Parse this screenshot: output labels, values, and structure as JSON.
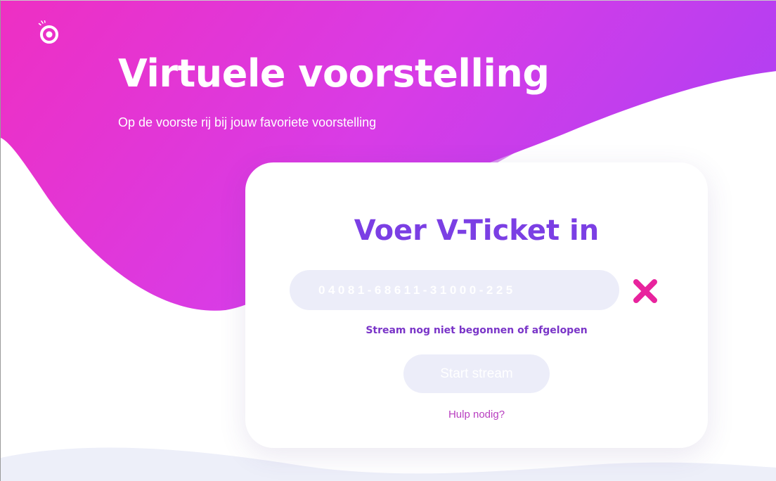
{
  "brand": {
    "logo_icon": "eye-logo-icon",
    "gradient_start": "#ee2fc3",
    "gradient_end": "#b83ff0"
  },
  "hero": {
    "title": "Virtuele voorstelling",
    "subtitle": "Op de voorste rij bij jouw favoriete voorstelling"
  },
  "ticket_form": {
    "title": "Voer V-Ticket in",
    "ticket_code": "04081-68611-31000-225",
    "clear_icon": "close-icon",
    "status_message": "Stream nog niet begonnen of afgelopen",
    "start_button_label": "Start stream",
    "start_button_enabled": false,
    "help_link": "Hulp nodig?"
  },
  "colors": {
    "title_purple": "#7b3fe4",
    "clear_pink": "#e8239d",
    "help_pink": "#b83ec0",
    "input_background": "#ecedf9"
  }
}
